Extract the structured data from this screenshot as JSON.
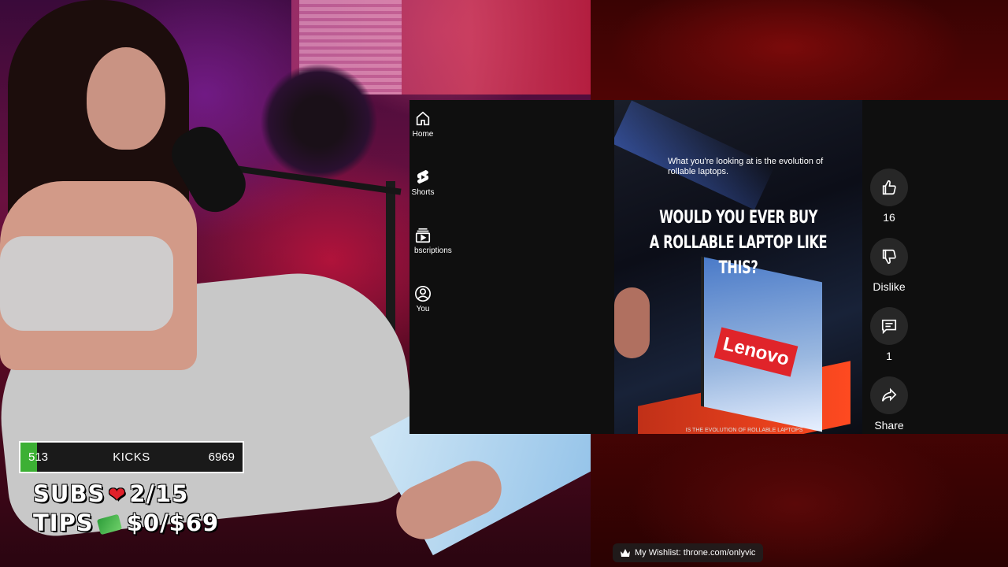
{
  "sidebar": {
    "items": [
      {
        "label": "Home",
        "icon": "home-icon"
      },
      {
        "label": "Shorts",
        "icon": "shorts-icon"
      },
      {
        "label": "bscriptions",
        "icon": "subscriptions-icon"
      },
      {
        "label": "You",
        "icon": "account-icon"
      }
    ]
  },
  "video": {
    "caption": "What you're looking at is the evolution of rollable laptops.",
    "headline_line1": "WOULD YOU EVER BUY",
    "headline_line2": "A ROLLABLE LAPTOP LIKE THIS?",
    "brand_text": "Lenovo",
    "subtitle_strip": "IS THE EVOLUTION OF ROLLABLE LAPTOPS"
  },
  "actions": {
    "like_count": "16",
    "dislike_label": "Dislike",
    "comment_count": "1",
    "share_label": "Share"
  },
  "stream": {
    "kicks": {
      "current": "513",
      "label": "KICKS",
      "goal": "6969",
      "progress": 0.0736
    },
    "subs": {
      "label": "SUBS",
      "value": "2/15"
    },
    "tips": {
      "label": "TIPS",
      "value": "$0/$69"
    },
    "wishlist": "My Wishlist: throne.com/onlyvic"
  },
  "colors": {
    "kicks_fill": "#3cb034",
    "yt_bg": "#0f0f0f",
    "heart": "#e0202a"
  }
}
